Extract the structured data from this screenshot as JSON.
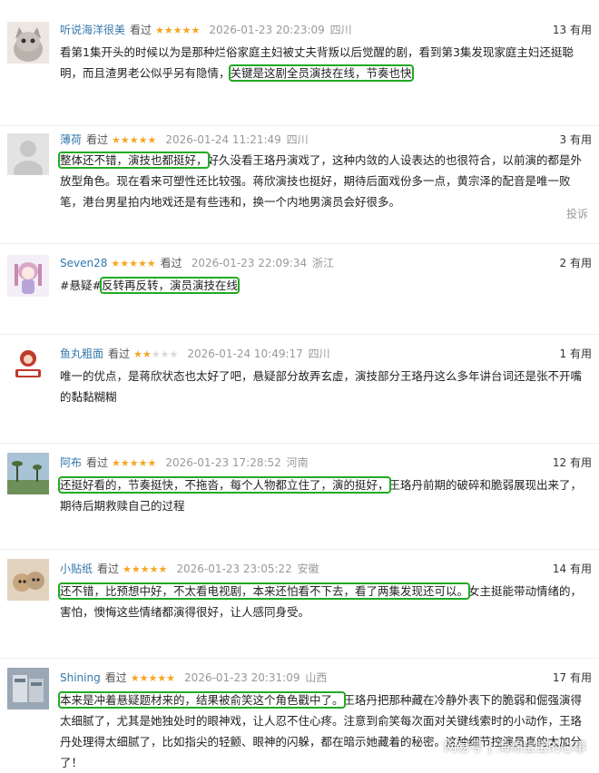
{
  "comments": [
    {
      "user": "听说海洋很美",
      "status": "看过",
      "stars": 5,
      "time": "2026-01-23 20:23:09",
      "location": "四川",
      "useful": "13 有用",
      "pre": "看第1集开头的时候以为是那种烂俗家庭主妇被丈夫背叛以后觉醒的剧，看到第3集发现家庭主妇还挺聪明，而且渣男老公似乎另有隐情，",
      "highlight": "关键是这剧全员演技在线，节奏也快",
      "post": ""
    },
    {
      "user": "薄荷",
      "status": "看过",
      "stars": 5,
      "time": "2026-01-24 11:21:49",
      "location": "四川",
      "useful": "3 有用",
      "pre": "",
      "highlight": "整体还不错，演技也都挺好，",
      "post": "好久没看王珞丹演戏了，这种内敛的人设表达的也很符合，以前演的都是外放型角色。现在看来可塑性还比较强。蒋欣演技也挺好，期待后面戏份多一点，黄宗泽的配音是唯一败笔，港台男星拍内地戏还是有些违和，换一个内地男演员会好很多。",
      "report": "投诉"
    },
    {
      "user": "Seven28",
      "status": "看过",
      "stars": 5,
      "time": "2026-01-23 22:09:34",
      "location": "浙江",
      "useful": "2 有用",
      "pre": "#悬疑#",
      "highlight": "反转再反转，演员演技在线",
      "post": ""
    },
    {
      "user": "鱼丸粗面",
      "status": "看过",
      "stars": 2,
      "time": "2026-01-24 10:49:17",
      "location": "四川",
      "useful": "1 有用",
      "pre": "唯一的优点，是蒋欣状态也太好了吧，悬疑部分故弄玄虚，演技部分王珞丹这么多年讲台词还是张不开嘴的黏黏糊糊",
      "highlight": "",
      "post": ""
    },
    {
      "user": "阿布",
      "status": "看过",
      "stars": 5,
      "time": "2026-01-23 17:28:52",
      "location": "河南",
      "useful": "12 有用",
      "pre": "",
      "highlight": "还挺好看的，节奏挺快，不拖沓，每个人物都立住了，演的挺好，",
      "post": "王珞丹前期的破碎和脆弱展现出来了，期待后期救赎自己的过程"
    },
    {
      "user": "小贴纸",
      "status": "看过",
      "stars": 5,
      "time": "2026-01-23 23:05:22",
      "location": "安徽",
      "useful": "14 有用",
      "pre": "",
      "highlight": "还不错，比预想中好，不太看电视剧，本来还怕看不下去，看了两集发现还可以。",
      "post": "女主挺能带动情绪的，害怕，懊悔这些情绪都演得很好，让人感同身受。"
    },
    {
      "user": "Shining",
      "status": "看过",
      "stars": 5,
      "time": "2026-01-23 20:31:09",
      "location": "山西",
      "useful": "17 有用",
      "pre": "",
      "highlight": "本来是冲着悬疑题材来的，结果被俞笑这个角色戳中了。",
      "post": "王珞丹把那种藏在冷静外表下的脆弱和倔强演得太细腻了，尤其是她独处时的眼神戏，让人忍不住心疼。注意到俞笑每次面对关键线索时的小动作，王珞丹处理得太细腻了，比如指尖的轻颤、眼神的闪躲，都在暗示她藏着的秘密。这种细节控演员真的太加分了！"
    }
  ],
  "watermark": {
    "source": "网易号",
    "author": "海绵宝宝的心事"
  },
  "colors": {
    "username": "#3377aa",
    "star": "#f5a623",
    "highlight_box": "#22aa22",
    "meta_gray": "#999999"
  }
}
